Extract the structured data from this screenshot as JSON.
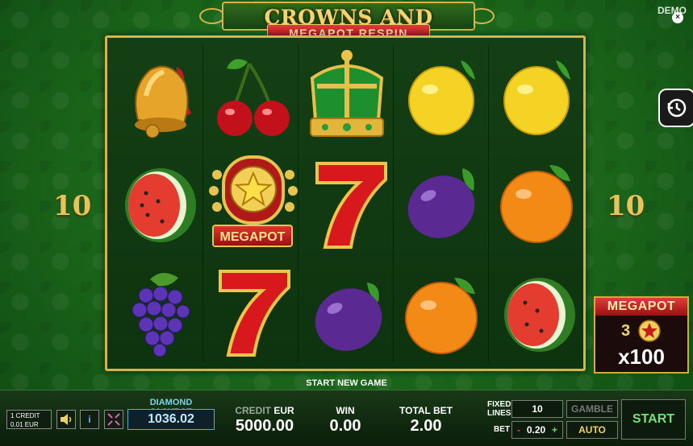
{
  "game": {
    "title": "CROWNS AND STARS",
    "subtitle": "MEGAPOT RESPIN",
    "demo_label": "DEMO",
    "close_symbol": "×"
  },
  "reels": {
    "symbols": [
      [
        "bell",
        "watermelon",
        "grapes"
      ],
      [
        "cherries",
        "megapot-star",
        "seven"
      ],
      [
        "crown",
        "seven",
        "plum"
      ],
      [
        "lemon",
        "plum",
        "orange"
      ],
      [
        "lemon",
        "orange",
        "watermelon"
      ]
    ],
    "megapot_symbol_label": "MEGAPOT",
    "lines_left": "10",
    "lines_right": "10"
  },
  "megapot_panel": {
    "title": "MEGAPOT",
    "count": "3",
    "multiplier": "x100"
  },
  "status_message": "START NEW GAME",
  "bottom": {
    "credit_line1": "1 CREDIT",
    "credit_line2": "0.01 EUR",
    "sound_icon": "speaker-icon",
    "info_label": "i",
    "jackpot_label": "DIAMOND JACKPOT",
    "jackpot_value": "1036.02",
    "credit_label": "CREDIT",
    "credit_currency": "EUR",
    "credit_value": "5000.00",
    "win_label": "WIN",
    "win_value": "0.00",
    "total_bet_label": "TOTAL BET",
    "total_bet_value": "2.00",
    "fixed_lines_label": "FIXED\nLINES",
    "fixed_lines_value": "10",
    "bet_label": "BET",
    "bet_minus": "-",
    "bet_value": "0.20",
    "bet_plus": "+",
    "gamble_label": "GAMBLE",
    "auto_label": "AUTO",
    "start_label": "START"
  },
  "colors": {
    "gold": "#d6b44c",
    "red": "#c41e1e",
    "felt_green": "#1d6a1c",
    "start_green": "#78e078"
  }
}
